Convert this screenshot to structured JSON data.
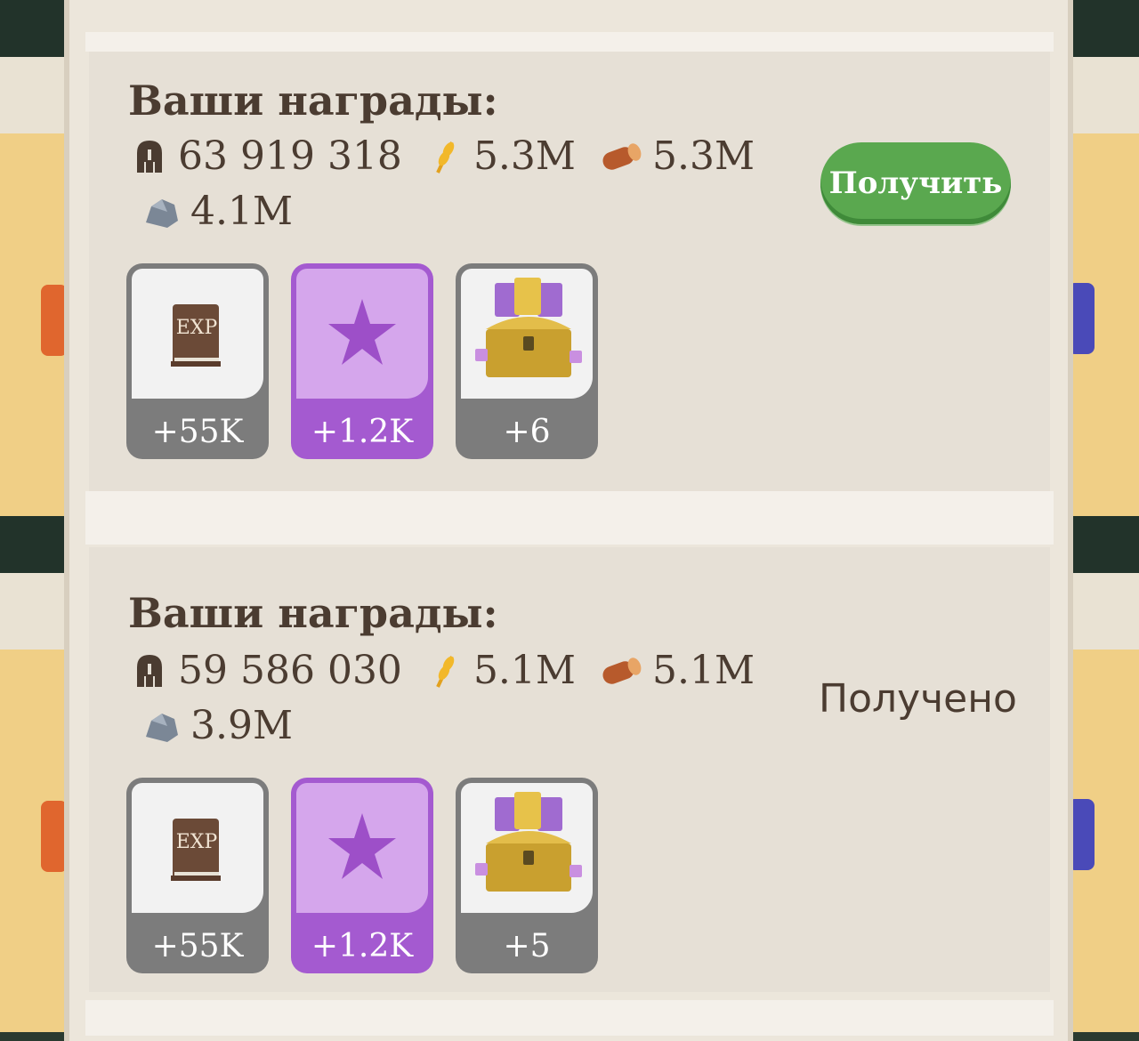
{
  "panels": [
    {
      "title": "Ваши награды:",
      "resources": {
        "power": "63 919 318",
        "wheat": "5.3M",
        "wood": "5.3M",
        "stone": "4.1M"
      },
      "action": {
        "type": "button",
        "label": "Получить"
      },
      "rewards": [
        {
          "icon": "exp-book-icon",
          "label": "EXP",
          "count": "+55K"
        },
        {
          "icon": "star-icon",
          "count": "+1.2K"
        },
        {
          "icon": "treasure-chest-icon",
          "count": "+6"
        }
      ]
    },
    {
      "title": "Ваши награды:",
      "resources": {
        "power": "59 586 030",
        "wheat": "5.1M",
        "wood": "5.1M",
        "stone": "3.9M"
      },
      "action": {
        "type": "status",
        "label": "Получено"
      },
      "rewards": [
        {
          "icon": "exp-book-icon",
          "label": "EXP",
          "count": "+55K"
        },
        {
          "icon": "star-icon",
          "count": "+1.2K"
        },
        {
          "icon": "treasure-chest-icon",
          "count": "+5"
        }
      ]
    }
  ],
  "colors": {
    "claim_button": "#5aa84f",
    "star_card": "#a45ad0",
    "text": "#4b3c31"
  }
}
